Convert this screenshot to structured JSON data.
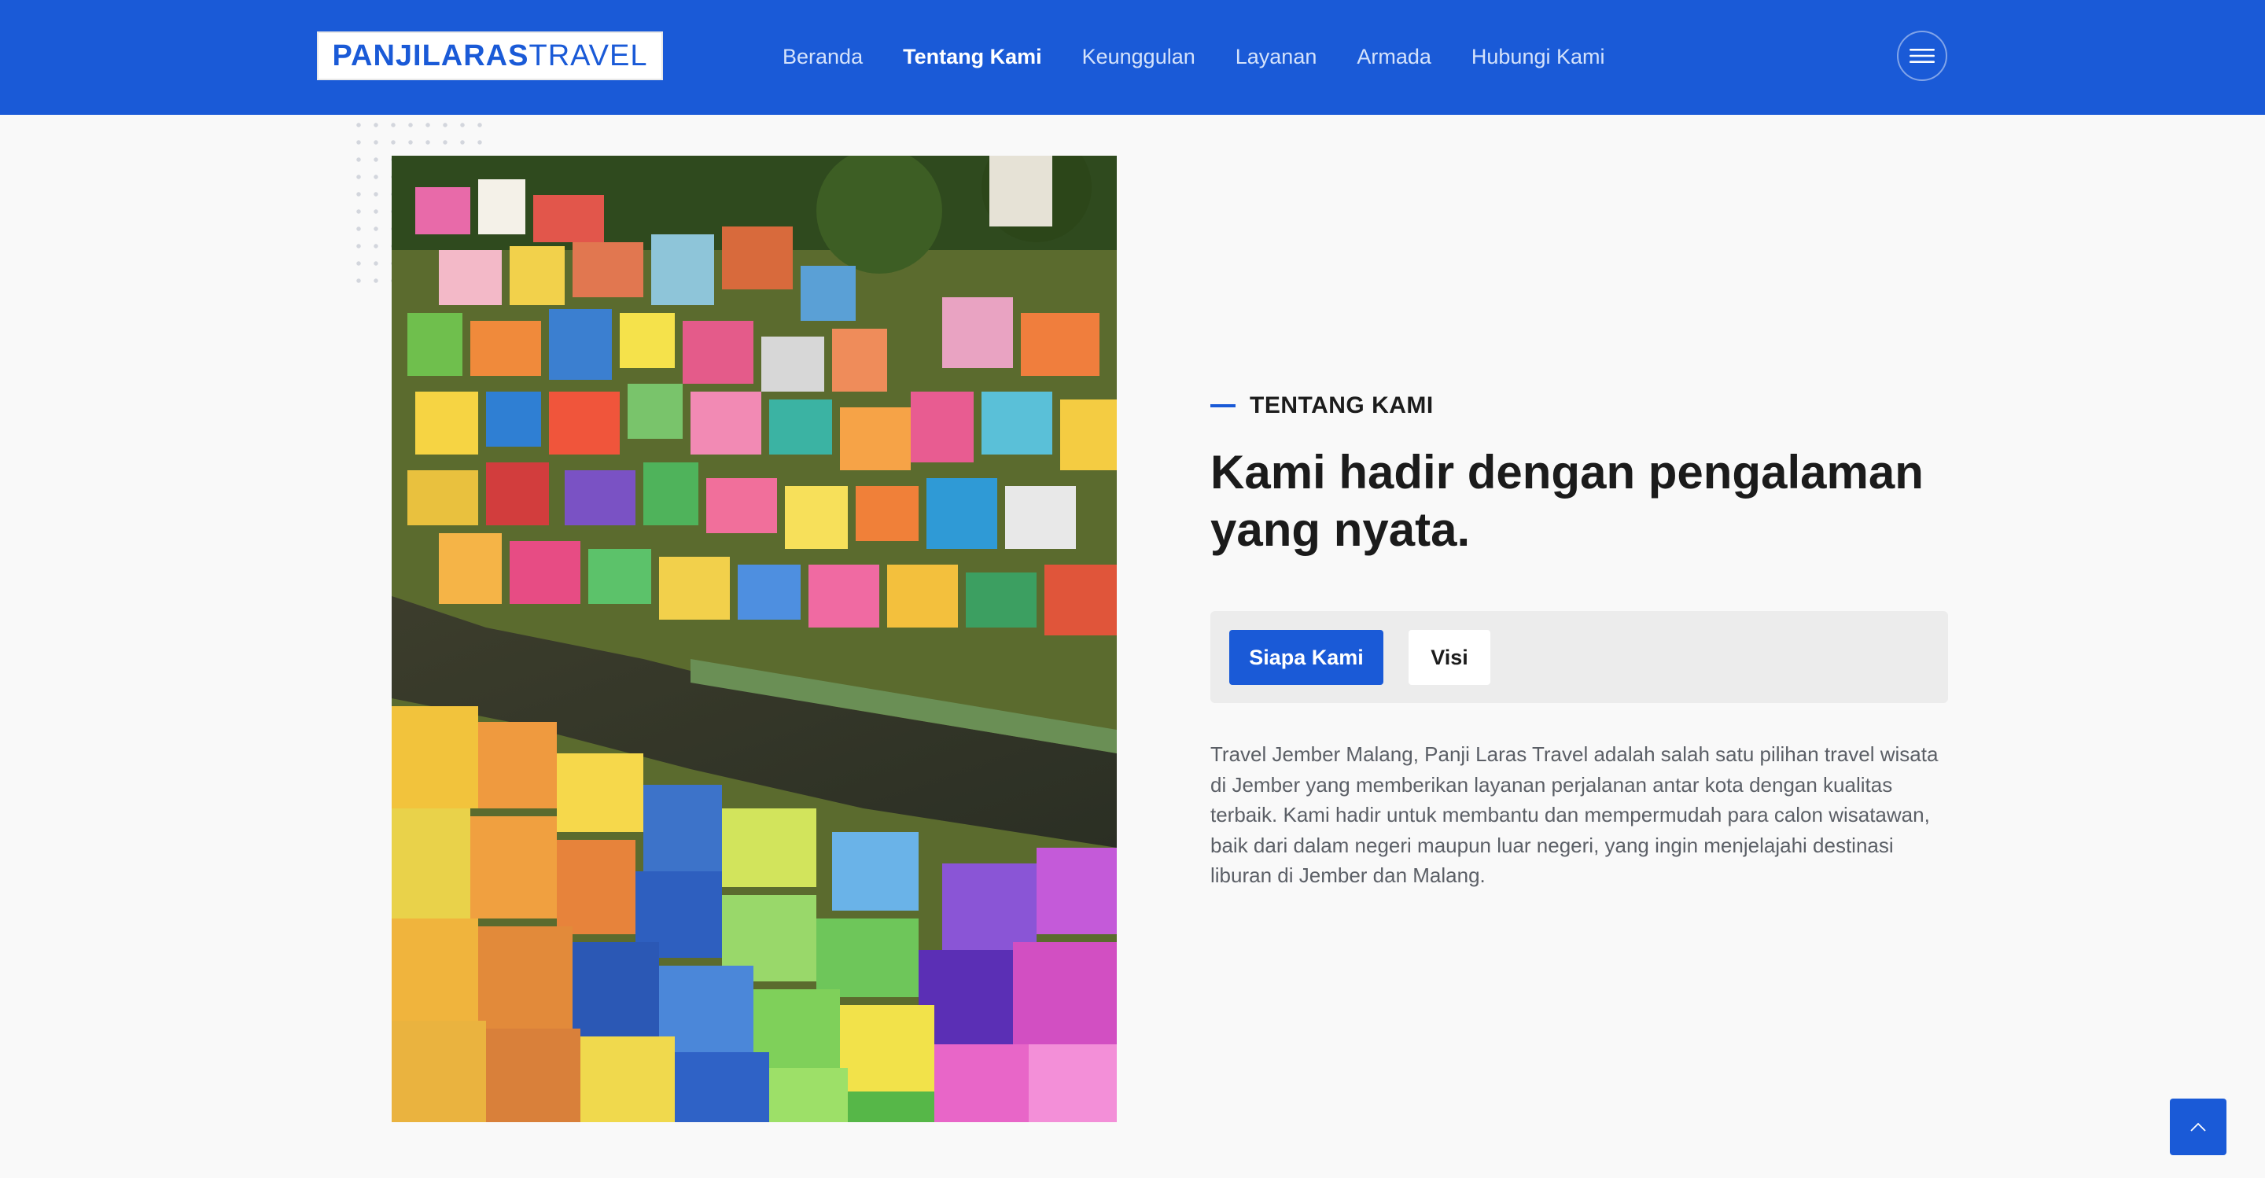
{
  "brand": {
    "name_bold": "PANJILARAS",
    "name_light": "TRAVEL",
    "primary_color": "#1a5ad7"
  },
  "nav": {
    "items": [
      {
        "label": "Beranda",
        "active": false
      },
      {
        "label": "Tentang Kami",
        "active": true
      },
      {
        "label": "Keunggulan",
        "active": false
      },
      {
        "label": "Layanan",
        "active": false
      },
      {
        "label": "Armada",
        "active": false
      },
      {
        "label": "Hubungi Kami",
        "active": false
      }
    ],
    "menu_icon": "hamburger-menu-icon"
  },
  "about": {
    "eyebrow": "TENTANG KAMI",
    "headline": "Kami hadir dengan pengalaman yang nyata.",
    "tabs": [
      {
        "label": "Siapa Kami",
        "active": true
      },
      {
        "label": "Visi",
        "active": false
      }
    ],
    "paragraph": "Travel Jember Malang, Panji Laras Travel adalah salah satu pilihan travel wisata di Jember yang memberikan layanan perjalanan antar kota dengan kualitas terbaik. Kami hadir untuk membantu dan mempermudah para calon wisatawan, baik dari dalam negeri maupun luar negeri, yang ingin menjelajahi destinasi liburan di Jember dan Malang."
  },
  "back_to_top": {
    "icon": "chevron-up-icon"
  }
}
